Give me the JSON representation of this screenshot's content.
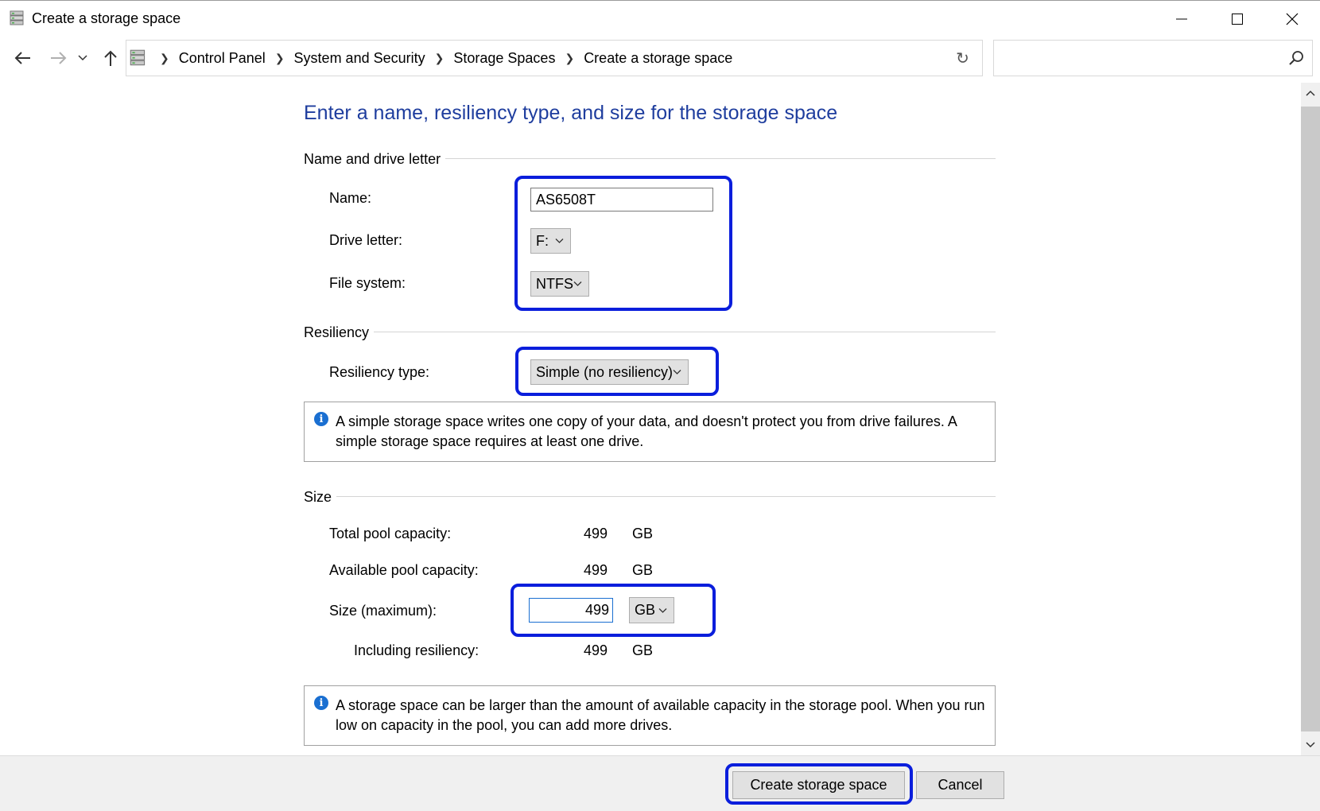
{
  "window": {
    "title": "Create a storage space"
  },
  "breadcrumb": {
    "items": [
      "Control Panel",
      "System and Security",
      "Storage Spaces",
      "Create a storage space"
    ]
  },
  "search": {
    "placeholder": ""
  },
  "page": {
    "heading": "Enter a name, resiliency type, and size for the storage space"
  },
  "name_section": {
    "title": "Name and drive letter",
    "name_label": "Name:",
    "name_value": "AS6508T",
    "drive_letter_label": "Drive letter:",
    "drive_letter_value": "F:",
    "file_system_label": "File system:",
    "file_system_value": "NTFS"
  },
  "resiliency_section": {
    "title": "Resiliency",
    "type_label": "Resiliency type:",
    "type_value": "Simple (no resiliency)",
    "info": "A simple storage space writes one copy of your data, and doesn't protect you from drive failures. A simple storage space requires at least one drive."
  },
  "size_section": {
    "title": "Size",
    "total_label": "Total pool capacity:",
    "total_value": "499",
    "total_unit": "GB",
    "available_label": "Available pool capacity:",
    "available_value": "499",
    "available_unit": "GB",
    "size_label": "Size (maximum):",
    "size_value": "499",
    "size_unit": "GB",
    "including_label": "Including resiliency:",
    "including_value": "499",
    "including_unit": "GB",
    "info": "A storage space can be larger than the amount of available capacity in the storage pool. When you run low on capacity in the pool, you can add more drives."
  },
  "footer": {
    "create_label": "Create storage space",
    "cancel_label": "Cancel"
  },
  "colors": {
    "heading": "#1e3d9e",
    "highlight": "#0a1edc",
    "info_icon": "#1a6fd1"
  },
  "icons": [
    "storage-spaces-icon",
    "back-arrow-icon",
    "forward-arrow-icon",
    "recent-chevron-icon",
    "up-arrow-icon",
    "refresh-icon",
    "search-icon",
    "info-icon",
    "chevron-down-icon"
  ]
}
